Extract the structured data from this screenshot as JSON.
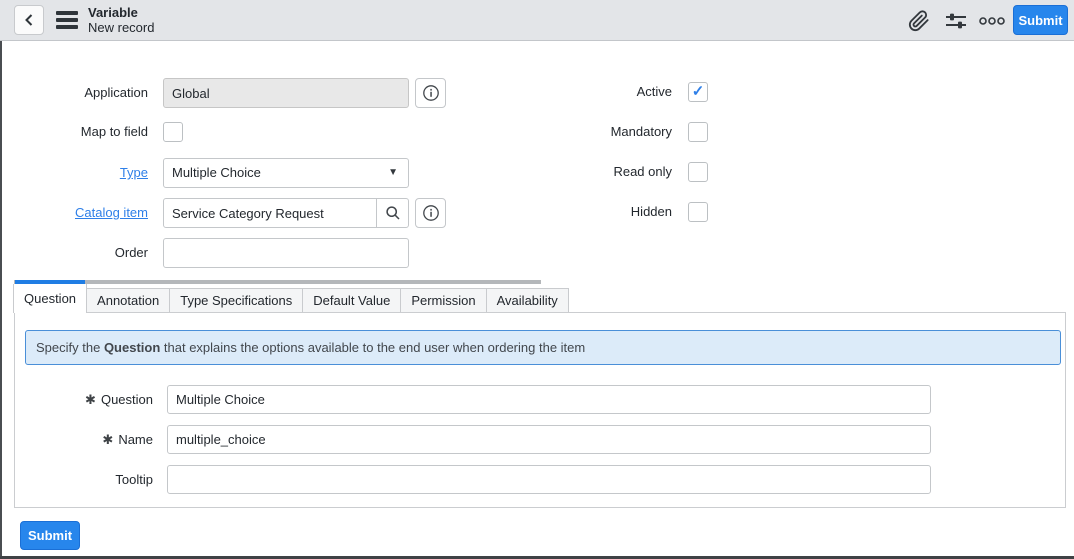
{
  "header": {
    "title": "Variable",
    "subtitle": "New record",
    "submit_label": "Submit"
  },
  "form": {
    "application": {
      "label": "Application",
      "value": "Global"
    },
    "map_to_field": {
      "label": "Map to field",
      "mark": ""
    },
    "type": {
      "label": "Type",
      "value": "Multiple Choice",
      "caret": "▼"
    },
    "catalog_item": {
      "label": "Catalog item",
      "value": "Service Category Request"
    },
    "order": {
      "label": "Order",
      "value": ""
    },
    "checkboxes": [
      {
        "label": "Active",
        "mark": "✓"
      },
      {
        "label": "Mandatory",
        "mark": ""
      },
      {
        "label": "Read only",
        "mark": ""
      },
      {
        "label": "Hidden",
        "mark": ""
      }
    ]
  },
  "tabs": [
    {
      "label": "Question"
    },
    {
      "label": "Annotation"
    },
    {
      "label": "Type Specifications"
    },
    {
      "label": "Default Value"
    },
    {
      "label": "Permission"
    },
    {
      "label": "Availability"
    }
  ],
  "question_tab": {
    "banner": {
      "prefix": "Specify the ",
      "bold": "Question",
      "suffix": " that explains the options available to the end user when ordering the item"
    },
    "fields": [
      {
        "label": "Question",
        "marker": "✱",
        "value": "Multiple Choice"
      },
      {
        "label": "Name",
        "marker": "✱",
        "value": "multiple_choice"
      },
      {
        "label": "Tooltip",
        "marker": "",
        "value": ""
      }
    ]
  },
  "footer": {
    "submit_label": "Submit"
  },
  "colors": {
    "primary_blue": "#2786ec",
    "link_blue": "#2e7fe8",
    "banner_bg": "#dcebf9",
    "banner_border": "#4a8fd8",
    "header_bg": "#e3e5e8",
    "tab_active_bar": "#1f7de4"
  }
}
